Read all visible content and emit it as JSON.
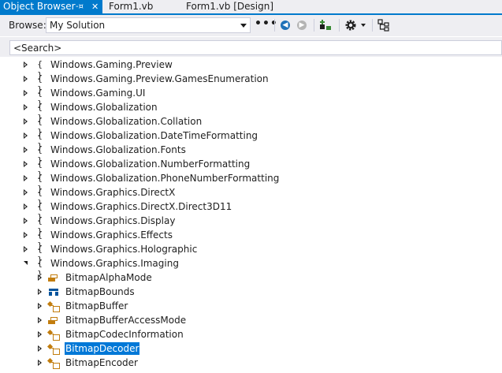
{
  "tabs": [
    {
      "label": "Object Browser",
      "active": true
    },
    {
      "label": "Form1.vb",
      "active": false
    },
    {
      "label": "Form1.vb [Design]",
      "active": false
    }
  ],
  "toolbar": {
    "browse_label": "Browse:",
    "browse_value": "My Solution",
    "more_label": "•••"
  },
  "search": {
    "placeholder": "<Search>"
  },
  "tree": {
    "namespaces": [
      "Windows.Gaming.Preview",
      "Windows.Gaming.Preview.GamesEnumeration",
      "Windows.Gaming.UI",
      "Windows.Globalization",
      "Windows.Globalization.Collation",
      "Windows.Globalization.DateTimeFormatting",
      "Windows.Globalization.Fonts",
      "Windows.Globalization.NumberFormatting",
      "Windows.Globalization.PhoneNumberFormatting",
      "Windows.Graphics.DirectX",
      "Windows.Graphics.DirectX.Direct3D11",
      "Windows.Graphics.Display",
      "Windows.Graphics.Effects",
      "Windows.Graphics.Holographic",
      "Windows.Graphics.Imaging"
    ],
    "types": [
      {
        "label": "BitmapAlphaMode",
        "kind": "enum"
      },
      {
        "label": "BitmapBounds",
        "kind": "struct"
      },
      {
        "label": "BitmapBuffer",
        "kind": "class"
      },
      {
        "label": "BitmapBufferAccessMode",
        "kind": "enum"
      },
      {
        "label": "BitmapCodecInformation",
        "kind": "class"
      },
      {
        "label": "BitmapDecoder",
        "kind": "class",
        "selected": true
      },
      {
        "label": "BitmapEncoder",
        "kind": "class"
      }
    ]
  },
  "colors": {
    "accent": "#007acc",
    "selection": "#0078d7",
    "icon_orange": "#c27d0e",
    "icon_blue": "#00539c"
  }
}
